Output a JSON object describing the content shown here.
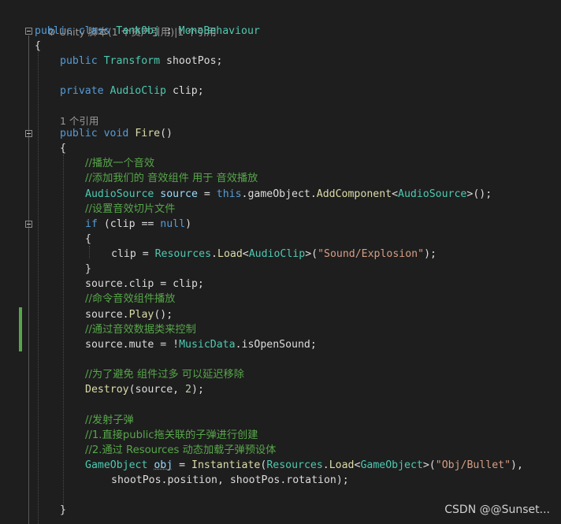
{
  "codelens": {
    "class_refs": "Unity 脚本(1 个资产引用)|1 个引用",
    "method_refs": "1 个引用"
  },
  "code": {
    "l_class_kw1": "public",
    "l_class_kw2": "class",
    "l_class_name": "TankObj",
    "l_class_colon": " : ",
    "l_class_base": "MonoBehaviour",
    "brace_open": "{",
    "brace_close": "}",
    "field1_kw": "public",
    "field1_type": "Transform",
    "field1_name": " shootPos;",
    "field2_kw": "private",
    "field2_type": "AudioClip",
    "field2_name": " clip;",
    "m_kw1": "public",
    "m_kw2": "void",
    "m_name": "Fire",
    "m_parens": "()",
    "c1": "//播放一个音效",
    "c2": "//添加我们的 音效组件 用于 音效播放",
    "s1_type": "AudioSource",
    "s1_var": " source",
    "s1_eq": " = ",
    "s1_this": "this",
    "s1_rest1": ".gameObject.",
    "s1_fn": "AddComponent",
    "s1_lt": "<",
    "s1_gtype": "AudioSource",
    "s1_end": ">();",
    "c3": "//设置音效切片文件",
    "if_kw": "if",
    "if_mid": " (clip == ",
    "if_null": "null",
    "if_end": ")",
    "s2_a": "clip = ",
    "s2_res": "Resources",
    "s2_dot": ".",
    "s2_fn": "Load",
    "s2_lt": "<",
    "s2_gtype": "AudioClip",
    "s2_gt": ">(",
    "s2_str": "\"Sound/Explosion\"",
    "s2_end": ");",
    "s3": "source.clip = clip;",
    "c4": "//命令音效组件播放",
    "s4_a": "source.",
    "s4_fn": "Play",
    "s4_end": "();",
    "c5": "//通过音效数据类来控制",
    "s5_a": "source.mute = !",
    "s5_type": "MusicData",
    "s5_end": ".isOpenSound;",
    "c6": "//为了避免 组件过多 可以延迟移除",
    "s6_fn": "Destroy",
    "s6_a": "(source, ",
    "s6_num": "2",
    "s6_end": ");",
    "c7": "//发射子弹",
    "c8": "//1.直接public拖关联的子弹进行创建",
    "c9": "//2.通过 Resources 动态加载子弹预设体",
    "s7_type": "GameObject",
    "s7_sp": " ",
    "s7_var": "obj",
    "s7_eq": " = ",
    "s7_fn": "Instantiate",
    "s7_p": "(",
    "s7_res": "Resources",
    "s7_dot": ".",
    "s7_load": "Load",
    "s7_lt": "<",
    "s7_gtype": "GameObject",
    "s7_gt": ">(",
    "s7_str": "\"Obj/Bullet\"",
    "s7_end": "),",
    "s8": "shootPos.position, shootPos.rotation);"
  },
  "watermark": "CSDN @@Sunset..."
}
